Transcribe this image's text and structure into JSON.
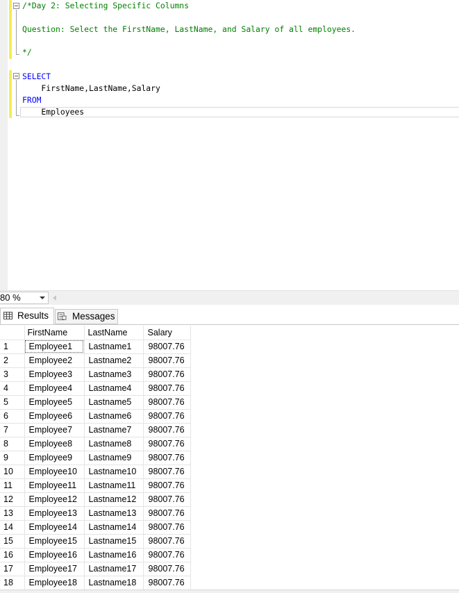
{
  "editor": {
    "lines": [
      {
        "text": "/*Day 2: Selecting Specific Columns",
        "kind": "comment"
      },
      {
        "text": "",
        "kind": "comment"
      },
      {
        "text": "Question: Select the FirstName, LastName, and Salary of all employees.",
        "kind": "comment"
      },
      {
        "text": "",
        "kind": "comment"
      },
      {
        "text": "*/",
        "kind": "comment"
      },
      {
        "text": "",
        "kind": "plain"
      },
      {
        "text": "SELECT",
        "kind": "keyword"
      },
      {
        "text": "    FirstName,LastName,Salary",
        "kind": "plain"
      },
      {
        "text": "FROM",
        "kind": "keyword"
      },
      {
        "text": "    Employees",
        "kind": "plain"
      }
    ]
  },
  "zoom": {
    "value": "80 %"
  },
  "tabs": {
    "results": "Results",
    "messages": "Messages"
  },
  "grid": {
    "columns": [
      "FirstName",
      "LastName",
      "Salary"
    ],
    "rows": [
      {
        "n": "1",
        "first": "Employee1",
        "last": "Lastname1",
        "salary": "98007.76"
      },
      {
        "n": "2",
        "first": "Employee2",
        "last": "Lastname2",
        "salary": "98007.76"
      },
      {
        "n": "3",
        "first": "Employee3",
        "last": "Lastname3",
        "salary": "98007.76"
      },
      {
        "n": "4",
        "first": "Employee4",
        "last": "Lastname4",
        "salary": "98007.76"
      },
      {
        "n": "5",
        "first": "Employee5",
        "last": "Lastname5",
        "salary": "98007.76"
      },
      {
        "n": "6",
        "first": "Employee6",
        "last": "Lastname6",
        "salary": "98007.76"
      },
      {
        "n": "7",
        "first": "Employee7",
        "last": "Lastname7",
        "salary": "98007.76"
      },
      {
        "n": "8",
        "first": "Employee8",
        "last": "Lastname8",
        "salary": "98007.76"
      },
      {
        "n": "9",
        "first": "Employee9",
        "last": "Lastname9",
        "salary": "98007.76"
      },
      {
        "n": "10",
        "first": "Employee10",
        "last": "Lastname10",
        "salary": "98007.76"
      },
      {
        "n": "11",
        "first": "Employee11",
        "last": "Lastname11",
        "salary": "98007.76"
      },
      {
        "n": "12",
        "first": "Employee12",
        "last": "Lastname12",
        "salary": "98007.76"
      },
      {
        "n": "13",
        "first": "Employee13",
        "last": "Lastname13",
        "salary": "98007.76"
      },
      {
        "n": "14",
        "first": "Employee14",
        "last": "Lastname14",
        "salary": "98007.76"
      },
      {
        "n": "15",
        "first": "Employee15",
        "last": "Lastname15",
        "salary": "98007.76"
      },
      {
        "n": "16",
        "first": "Employee16",
        "last": "Lastname16",
        "salary": "98007.76"
      },
      {
        "n": "17",
        "first": "Employee17",
        "last": "Lastname17",
        "salary": "98007.76"
      },
      {
        "n": "18",
        "first": "Employee18",
        "last": "Lastname18",
        "salary": "98007.76"
      }
    ]
  }
}
